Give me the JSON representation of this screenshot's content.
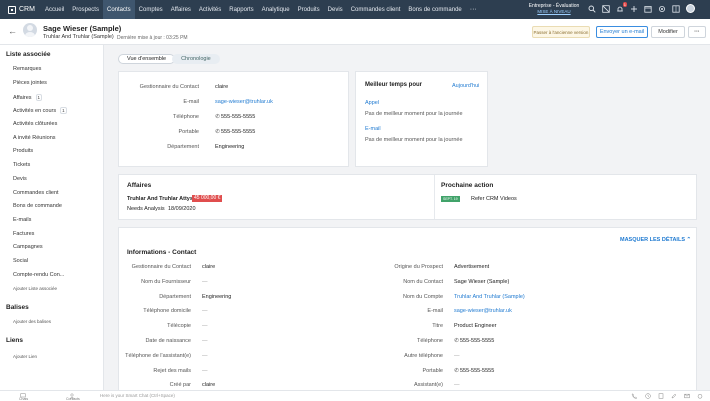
{
  "topnav": {
    "brand": "CRM",
    "items": [
      "Accueil",
      "Prospects",
      "Contacts",
      "Comptes",
      "Affaires",
      "Activités",
      "Rapports",
      "Analytique",
      "Produits",
      "Devis",
      "Commandes client",
      "Bons de commande"
    ],
    "more": "···",
    "edition_line": "Entreprise - Évaluation",
    "upgrade_label": "MISE À NIVEAU",
    "notification_count": "1"
  },
  "record": {
    "name": "Sage Wieser (Sample)",
    "company": "Truhlar And Truhlar (Sample)",
    "last_modified": "Dernière mise à jour : 03:25 PM",
    "old_version_label": "Passer à l'ancienne version",
    "send_email_label": "Envoyer un e-mail",
    "edit_label": "Modifier",
    "more_label": "···"
  },
  "sidebar": {
    "related_title": "Liste associée",
    "items": [
      {
        "label": "Remarques",
        "count": ""
      },
      {
        "label": "Pièces jointes",
        "count": ""
      },
      {
        "label": "Affaires",
        "count": "1"
      },
      {
        "label": "Activités en cours",
        "count": "1"
      },
      {
        "label": "Activités clôturées",
        "count": ""
      },
      {
        "label": "A invité Réunions",
        "count": ""
      },
      {
        "label": "Produits",
        "count": ""
      },
      {
        "label": "Tickets",
        "count": ""
      },
      {
        "label": "Devis",
        "count": ""
      },
      {
        "label": "Commandes client",
        "count": ""
      },
      {
        "label": "Bons de commande",
        "count": ""
      },
      {
        "label": "E-mails",
        "count": ""
      },
      {
        "label": "Factures",
        "count": ""
      },
      {
        "label": "Campagnes",
        "count": ""
      },
      {
        "label": "Social",
        "count": ""
      },
      {
        "label": "Compte-rendu Con...",
        "count": ""
      }
    ],
    "add_related": "Ajouter Liste associée",
    "tags_title": "Balises",
    "add_tags": "Ajouter des balises",
    "links_title": "Liens",
    "add_link": "Ajouter Lien"
  },
  "tabs": {
    "overview": "Vue d'ensemble",
    "timeline": "Chronologie"
  },
  "overview": {
    "rows": [
      {
        "label": "Gestionnaire du Contact",
        "value": "claire"
      },
      {
        "label": "E-mail",
        "value": "sage-wieser@truhlar.uk"
      },
      {
        "label": "Téléphone",
        "value": "555-555-5555"
      },
      {
        "label": "Portable",
        "value": "555-555-5555"
      },
      {
        "label": "Département",
        "value": "Engineering"
      }
    ],
    "best_time": {
      "title": "Meilleur temps pour",
      "period": "Aujourd'hui",
      "call_label": "Appel",
      "call_text": "Pas de meilleur moment pour la journée",
      "email_label": "E-mail",
      "email_text": "Pas de meilleur moment pour la journée"
    }
  },
  "deals": {
    "title": "Affaires",
    "deal_name": "Truhlar And Truhlar Attys",
    "amount": "45 000,00 €",
    "stage": "Needs Analysis",
    "date": "18/09/2020"
  },
  "next_action": {
    "title": "Prochaine action",
    "date_badge": "SEPT. 19",
    "text": "Refer CRM Videos"
  },
  "info": {
    "title": "Informations - Contact",
    "hide_details": "MASQUER LES DÉTAILS",
    "left": [
      {
        "label": "Gestionnaire du Contact",
        "value": "claire"
      },
      {
        "label": "Nom du Fournisseur",
        "value": "—"
      },
      {
        "label": "Département",
        "value": "Engineering"
      },
      {
        "label": "Téléphone domicile",
        "value": "—"
      },
      {
        "label": "Télécopie",
        "value": "—"
      },
      {
        "label": "Date de naissance",
        "value": "—"
      },
      {
        "label": "Téléphone de l'assistant(e)",
        "value": "—"
      },
      {
        "label": "Rejet des mails",
        "value": "—"
      },
      {
        "label": "Créé par",
        "value": "claire"
      }
    ],
    "right": [
      {
        "label": "Origine du Prospect",
        "value": "Advertisement"
      },
      {
        "label": "Nom du Contact",
        "value": "Sage Wieser (Sample)"
      },
      {
        "label": "Nom du Compte",
        "value": "Truhlar And Truhlar (Sample)"
      },
      {
        "label": "E-mail",
        "value": "sage-wieser@truhlar.uk"
      },
      {
        "label": "Titre",
        "value": "Product Engineer"
      },
      {
        "label": "Téléphone",
        "value": "555-555-5555"
      },
      {
        "label": "Autre téléphone",
        "value": "—"
      },
      {
        "label": "Portable",
        "value": "555-555-5555"
      },
      {
        "label": "Assistant(e)",
        "value": "—"
      }
    ]
  },
  "footer": {
    "chats_label": "Chats",
    "contacts_label": "Contacts",
    "smart_chat": "Here is your Smart Chat (Ctrl+Space)"
  }
}
